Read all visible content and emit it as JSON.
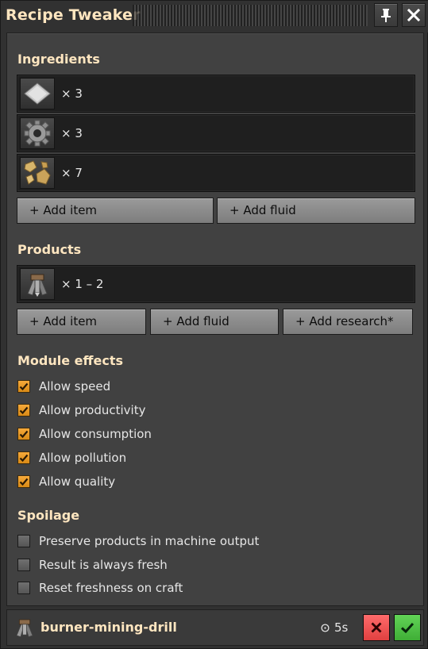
{
  "window": {
    "title": "Recipe Tweaker"
  },
  "ingredients": {
    "title": "Ingredients",
    "items": [
      {
        "icon": "iron-plate-icon",
        "amount": "× 3"
      },
      {
        "icon": "iron-gear-wheel-icon",
        "amount": "× 3"
      },
      {
        "icon": "stone-icon",
        "amount": "× 7"
      }
    ],
    "add_item_label": "+ Add item",
    "add_fluid_label": "+ Add fluid"
  },
  "products": {
    "title": "Products",
    "items": [
      {
        "icon": "burner-mining-drill-icon",
        "amount": "× 1 – 2"
      }
    ],
    "add_item_label": "+ Add item",
    "add_fluid_label": "+ Add fluid",
    "add_research_label": "+ Add research*"
  },
  "module_effects": {
    "title": "Module effects",
    "options": [
      {
        "label": "Allow speed",
        "checked": true
      },
      {
        "label": "Allow productivity",
        "checked": true
      },
      {
        "label": "Allow consumption",
        "checked": true
      },
      {
        "label": "Allow pollution",
        "checked": true
      },
      {
        "label": "Allow quality",
        "checked": true
      }
    ]
  },
  "spoilage": {
    "title": "Spoilage",
    "options": [
      {
        "label": "Preserve products in machine output",
        "checked": false
      },
      {
        "label": "Result is always fresh",
        "checked": false
      },
      {
        "label": "Reset freshness on craft",
        "checked": false
      }
    ]
  },
  "footer": {
    "recipe_name": "burner-mining-drill",
    "time": "5s"
  },
  "colors": {
    "heading": "#ffe6c0",
    "checkbox_on": "#f0a030",
    "cancel": "#f05050",
    "confirm": "#50c848"
  }
}
